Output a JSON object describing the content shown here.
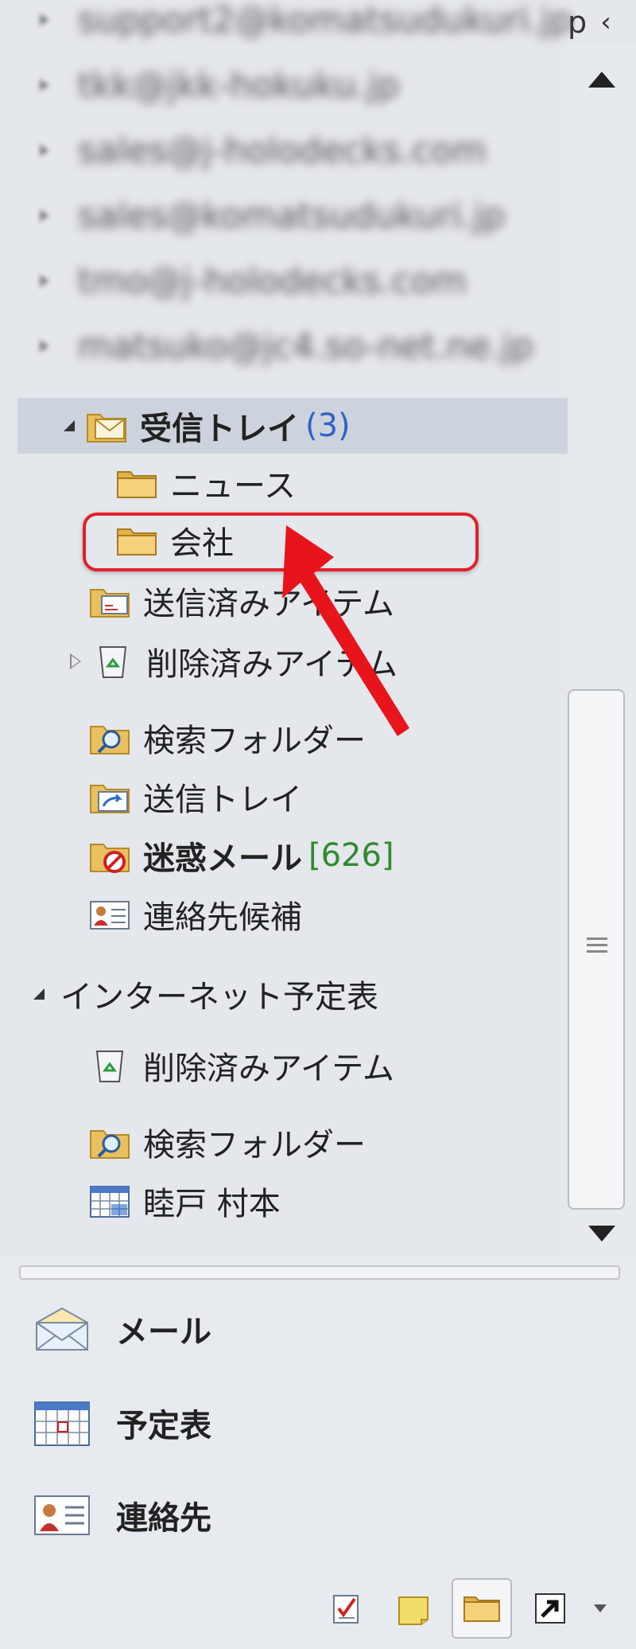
{
  "header": {
    "fragment": "p",
    "collapse_glyph": "‹"
  },
  "accounts": [
    "support2@komatsudukuri.jp",
    "tkk@jkk-hokuku.jp",
    "sales@j-holodecks.com",
    "sales@komatsudukuri.jp",
    "tmo@j-holodecks.com",
    "matsuko@jc4.so-net.ne.jp"
  ],
  "inbox": {
    "label": "受信トレイ",
    "count": "(3)"
  },
  "folders": {
    "news": "ニュース",
    "company": "会社",
    "sent": "送信済みアイテム",
    "deleted": "削除済みアイテム",
    "search": "検索フォルダー",
    "outbox": "送信トレイ",
    "junk": "迷惑メール",
    "junk_count": "[626]",
    "suggested_contacts": "連絡先候補"
  },
  "internet_calendar": {
    "label": "インターネット予定表",
    "deleted": "削除済みアイテム",
    "search": "検索フォルダー",
    "calendar": "睦戸 村本"
  },
  "nav": {
    "mail": "メール",
    "calendar": "予定表",
    "contacts": "連絡先"
  },
  "colors": {
    "highlight": "#e0202a",
    "selected_row": "#cdd3dc",
    "count_blue": "#2f62c8",
    "count_green": "#2f8a2f"
  }
}
